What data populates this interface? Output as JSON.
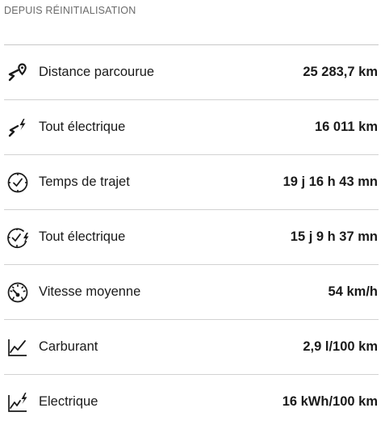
{
  "section": {
    "title": "DEPUIS RÉINITIALISATION"
  },
  "rows": [
    {
      "icon": "route-pin-icon",
      "label": "Distance parcourue",
      "value": "25 283,7 km"
    },
    {
      "icon": "route-electric-icon",
      "label": "Tout électrique",
      "value": "16 011 km"
    },
    {
      "icon": "clock-icon",
      "label": "Temps de trajet",
      "value": "19 j 16 h 43 mn"
    },
    {
      "icon": "clock-electric-icon",
      "label": "Tout électrique",
      "value": "15 j 9 h 37 mn"
    },
    {
      "icon": "speedometer-icon",
      "label": "Vitesse moyenne",
      "value": "54 km/h"
    },
    {
      "icon": "fuel-chart-icon",
      "label": "Carburant",
      "value": "2,9 l/100 km"
    },
    {
      "icon": "electric-chart-icon",
      "label": "Electrique",
      "value": "16 kWh/100 km"
    }
  ]
}
